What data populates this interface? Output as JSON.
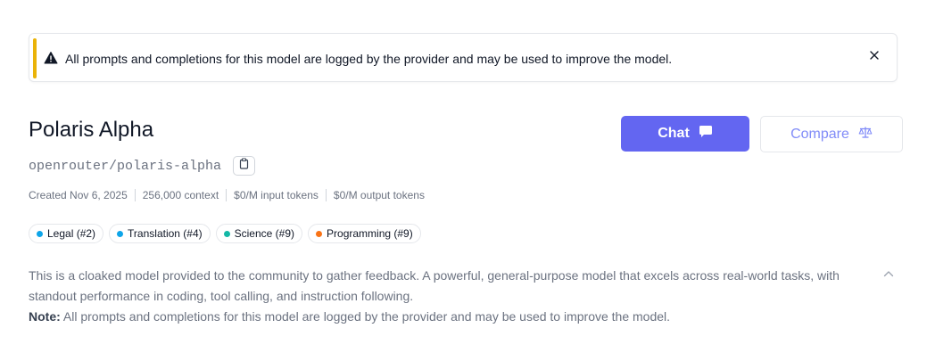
{
  "banner": {
    "text": "All prompts and completions for this model are logged by the provider and may be used to improve the model.",
    "icon": "warning-triangle-icon",
    "accent_color": "#eab308"
  },
  "model": {
    "name": "Polaris Alpha",
    "slug": "openrouter/polaris-alpha"
  },
  "meta": {
    "created": "Created Nov 6, 2025",
    "context": "256,000 context",
    "input_price": "$0/M input tokens",
    "output_price": "$0/M output tokens"
  },
  "categories": [
    {
      "label": "Legal (#2)",
      "color": "#0ea5e9"
    },
    {
      "label": "Translation (#4)",
      "color": "#0ea5e9"
    },
    {
      "label": "Science (#9)",
      "color": "#14b8a6"
    },
    {
      "label": "Programming (#9)",
      "color": "#f97316"
    }
  ],
  "description": {
    "text": "This is a cloaked model provided to the community to gather feedback. A powerful, general-purpose model that excels across real-world tasks, with standout performance in coding, tool calling, and instruction following.",
    "note_label": "Note:",
    "note_text": " All prompts and completions for this model are logged by the provider and may be used to improve the model."
  },
  "actions": {
    "chat_label": "Chat",
    "compare_label": "Compare",
    "accent_color": "#6366f1"
  }
}
